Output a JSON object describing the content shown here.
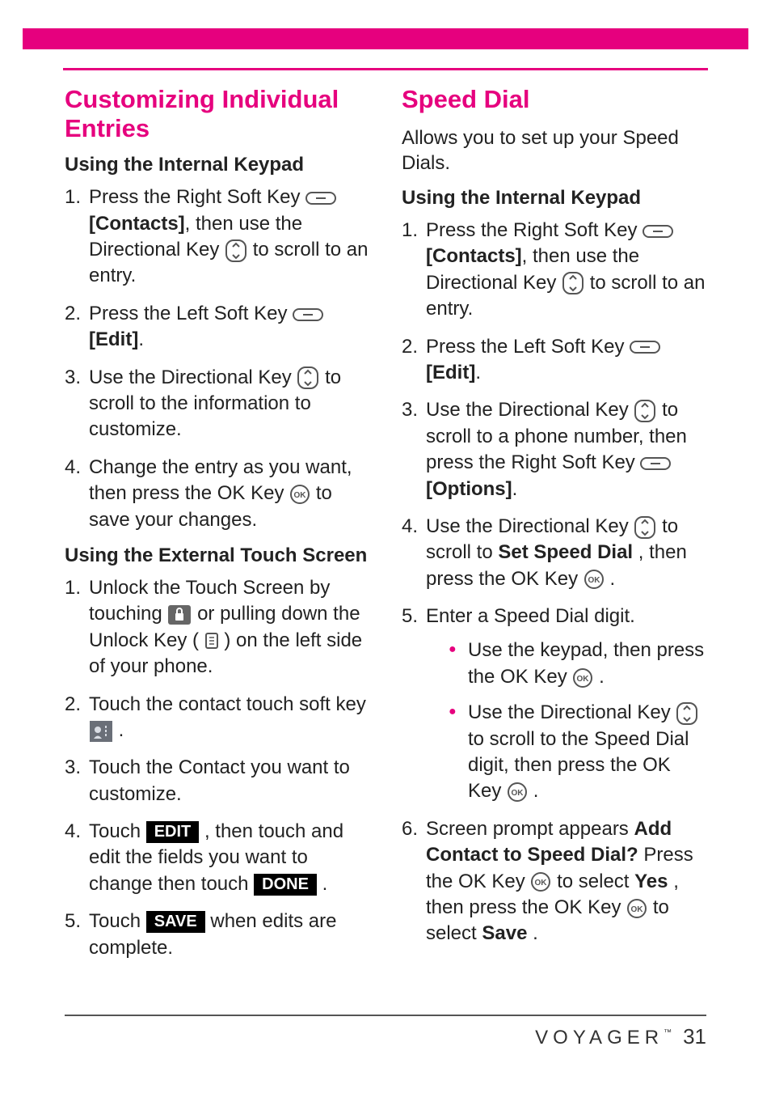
{
  "left": {
    "title": "Customizing Individual Entries",
    "sub1": "Using the Internal Keypad",
    "s1": {
      "p1a": "Press the Right Soft Key ",
      "p1b": "[Contacts]",
      "p1c": ", then use the Directional Key ",
      "p1d": " to scroll to an entry.",
      "p2a": "Press the Left Soft Key ",
      "p2b": "[Edit]",
      "p3a": "Use the Directional Key ",
      "p3b": " to scroll to the information to customize.",
      "p4a": "Change the entry as you want, then press the OK Key ",
      "p4b": " to save your changes."
    },
    "sub2": "Using the External Touch Screen",
    "s2": {
      "p1a": "Unlock the Touch Screen by touching ",
      "p1b": " or pulling down the Unlock Key ( ",
      "p1c": " ) on the left side of your phone.",
      "p2a": "Touch the contact touch soft key ",
      "p3a": "Touch the Contact you want to customize.",
      "p4a": "Touch ",
      "p4btn1": "EDIT",
      "p4b": " , then touch and edit the fields you want to change then touch ",
      "p4btn2": "DONE",
      "p4c": " .",
      "p5a": "Touch ",
      "p5btn": "SAVE",
      "p5b": " when edits are complete."
    }
  },
  "right": {
    "title": "Speed Dial",
    "intro": "Allows you to set up your Speed Dials.",
    "sub1": "Using the Internal Keypad",
    "s1": {
      "p1a": "Press the Right Soft Key ",
      "p1b": "[Contacts]",
      "p1c": ", then use the Directional Key ",
      "p1d": " to scroll to an entry.",
      "p2a": "Press the Left Soft Key ",
      "p2b": "[Edit]",
      "p3a": "Use the Directional Key ",
      "p3b": " to scroll to a phone number, then press the Right Soft Key ",
      "p3c": "[Options]",
      "p4a": "Use the Directional Key ",
      "p4b": " to scroll to ",
      "p4c": "Set Speed Dial",
      "p4d": ", then press the OK Key ",
      "p5a": "Enter a Speed Dial digit.",
      "b1a": "Use the keypad, then press the OK Key ",
      "b2a": "Use the Directional Key ",
      "b2b": " to scroll to the Speed Dial digit, then press the OK Key ",
      "p6a": "Screen prompt appears ",
      "p6b": "Add Contact to Speed Dial?",
      "p6c": " Press the OK Key ",
      "p6d": " to select ",
      "p6e": "Yes",
      "p6f": ", then press the OK Key ",
      "p6g": " to select ",
      "p6h": "Save",
      "p6i": "."
    }
  },
  "footer": {
    "brand": "VOYAGER",
    "tm": "™",
    "page": "31"
  }
}
